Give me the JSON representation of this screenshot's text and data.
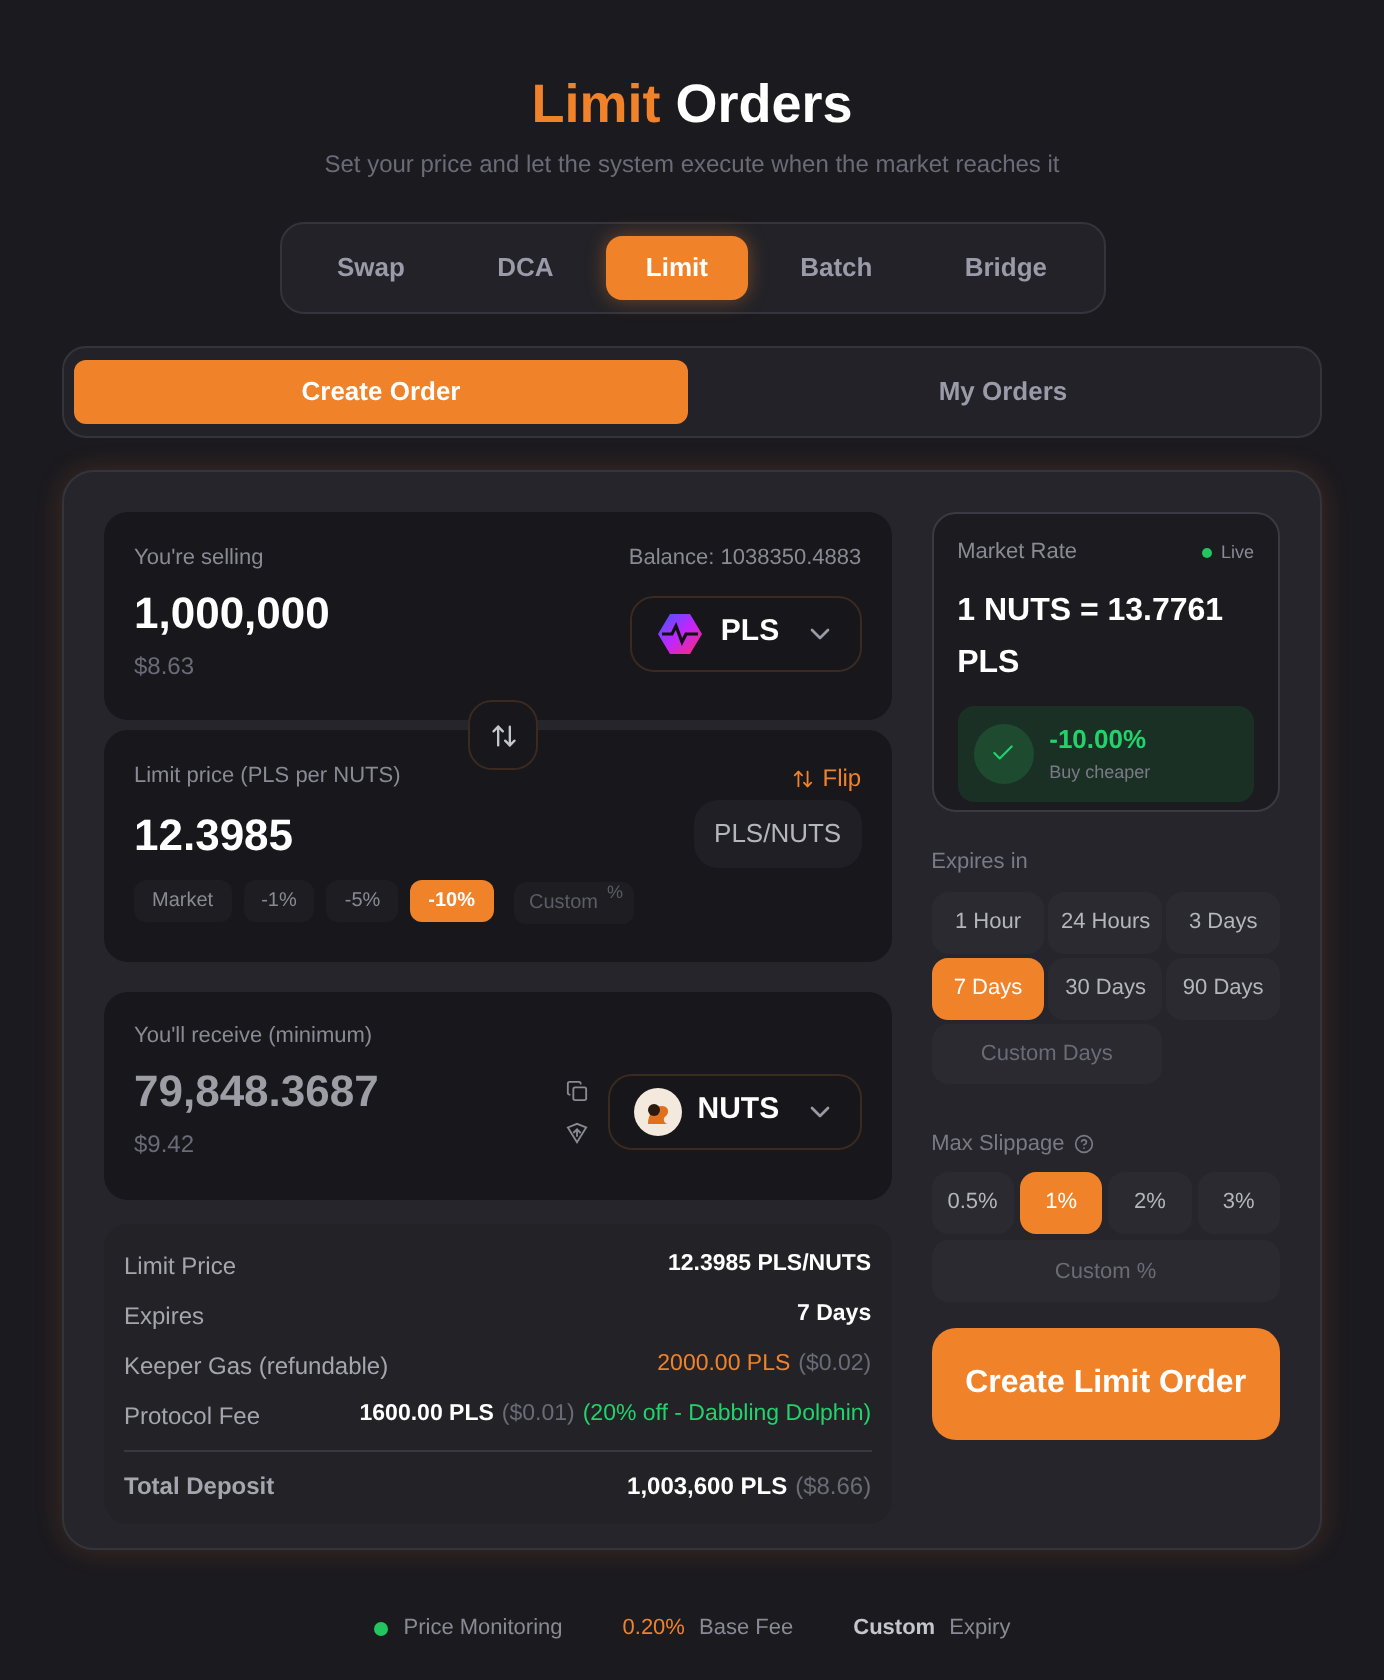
{
  "header": {
    "title_accent": "Limit",
    "title_rest": "Orders",
    "subtitle": "Set your price and let the system execute when the market reaches it"
  },
  "tabs": [
    {
      "label": "Swap",
      "selected": false
    },
    {
      "label": "DCA",
      "selected": false
    },
    {
      "label": "Limit",
      "selected": true
    },
    {
      "label": "Batch",
      "selected": false
    },
    {
      "label": "Bridge",
      "selected": false
    }
  ],
  "subtabs": [
    {
      "label": "Create Order",
      "selected": true
    },
    {
      "label": "My Orders",
      "selected": false
    }
  ],
  "sell": {
    "label": "You're selling",
    "balance": "Balance: 1038350.4883",
    "amount": "1,000,000",
    "usd": "$8.63",
    "token": "PLS"
  },
  "limit": {
    "label": "Limit price (PLS per NUTS)",
    "flip": "Flip",
    "value": "12.3985",
    "pair": "PLS/NUTS",
    "presets": [
      {
        "label": "Market",
        "selected": false
      },
      {
        "label": "-1%",
        "selected": false
      },
      {
        "label": "-5%",
        "selected": false
      },
      {
        "label": "-10%",
        "selected": true
      }
    ],
    "custom_placeholder": "Custom",
    "custom_suffix": "%"
  },
  "receive": {
    "label": "You'll receive (minimum)",
    "amount": "79,848.3687",
    "usd": "$9.42",
    "token": "NUTS"
  },
  "summary": [
    {
      "label": "Limit Price",
      "parts": [
        {
          "text": "12.3985 PLS/NUTS",
          "kind": "amount"
        }
      ]
    },
    {
      "label": "Expires",
      "parts": [
        {
          "text": "7 Days",
          "kind": "amount"
        }
      ]
    },
    {
      "label": "Keeper Gas (refundable)",
      "parts": [
        {
          "text": "2000.00 PLS",
          "kind": "refundable"
        },
        {
          "text": "($0.02)",
          "kind": "usd"
        }
      ]
    },
    {
      "label": "Protocol Fee",
      "parts": [
        {
          "text": "1600.00 PLS",
          "kind": "amount"
        },
        {
          "text": "($0.01)",
          "kind": "usd"
        },
        {
          "text": "(20% off - Dabbling Dolphin)",
          "kind": "discount"
        }
      ]
    }
  ],
  "total": {
    "label": "Total Deposit",
    "parts": [
      {
        "text": "1,003,600 PLS",
        "kind": "amount"
      },
      {
        "text": "($8.66)",
        "kind": "usd"
      }
    ]
  },
  "market": {
    "label": "Market Rate",
    "live": "Live",
    "rate": "1 NUTS = 13.7761 PLS",
    "change": "-10.00%",
    "note": "Buy cheaper"
  },
  "expires": {
    "label": "Expires in",
    "options": [
      {
        "label": "1 Hour",
        "selected": false
      },
      {
        "label": "24 Hours",
        "selected": false
      },
      {
        "label": "3 Days",
        "selected": false
      },
      {
        "label": "7 Days",
        "selected": true
      },
      {
        "label": "30 Days",
        "selected": false
      },
      {
        "label": "90 Days",
        "selected": false
      }
    ],
    "custom_placeholder": "Custom Days"
  },
  "slippage": {
    "label": "Max Slippage",
    "options": [
      {
        "label": "0.5%",
        "selected": false
      },
      {
        "label": "1%",
        "selected": true
      },
      {
        "label": "2%",
        "selected": false
      },
      {
        "label": "3%",
        "selected": false
      }
    ],
    "custom_placeholder": "Custom %"
  },
  "submit": "Create Limit Order",
  "footer": [
    {
      "kind": "dot",
      "color": "#22c55e",
      "text": "Price Monitoring"
    },
    {
      "kind": "accent",
      "accent": "0.20%",
      "text": "Base Fee"
    },
    {
      "kind": "bold",
      "accent": "Custom",
      "text": "Expiry"
    }
  ]
}
